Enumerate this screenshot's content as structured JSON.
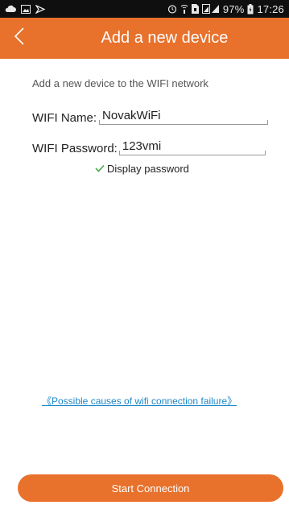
{
  "status_bar": {
    "battery_percent": "97%",
    "time": "17:26",
    "icons": [
      "cloud-icon",
      "image-icon",
      "cast-icon",
      "alarm-icon",
      "wifi-calling-icon",
      "sim-icon",
      "signal-icon",
      "battery-icon"
    ]
  },
  "app_bar": {
    "title": "Add a new device",
    "back_icon": "back-chevron-icon"
  },
  "form": {
    "intro": "Add a new device to the WIFI network",
    "wifi_name_label": "WIFI Name:",
    "wifi_name_value": "NovakWiFi",
    "wifi_password_label": "WIFI Password:",
    "wifi_password_value": "123vmi",
    "display_password_label": "Display password",
    "display_password_checked": true
  },
  "help_link": "《Possible causes of wifi connection failure》",
  "start_button": "Start Connection",
  "colors": {
    "accent": "#e8712c",
    "link": "#1e88c9",
    "check": "#3aa63a"
  }
}
